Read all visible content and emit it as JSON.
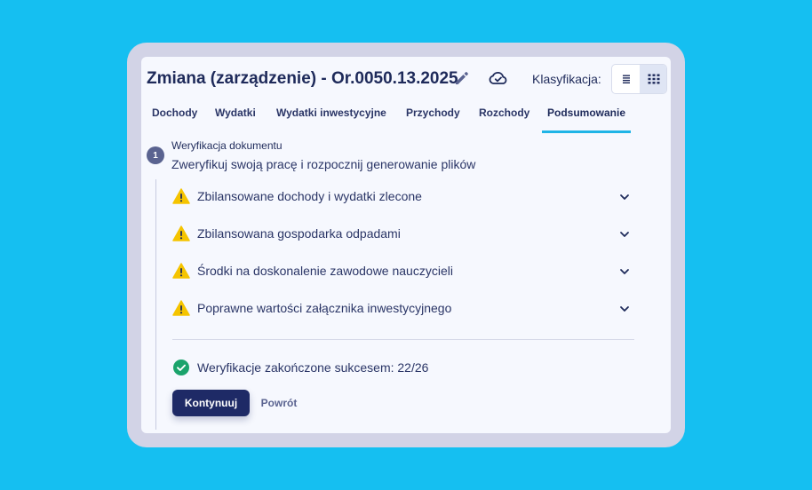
{
  "header": {
    "title": "Zmiana (zarządzenie) - Or.0050.13.2025",
    "classification_label": "Klasyfikacja:",
    "edit_icon": "pencil-icon",
    "cloud_icon": "cloud-check-icon",
    "view_modes": [
      "list-view-icon",
      "grid-view-icon"
    ],
    "active_view": "grid"
  },
  "tabs": [
    {
      "label": "Dochody",
      "active": false
    },
    {
      "label": "Wydatki",
      "active": false
    },
    {
      "label": "Wydatki inwestycyjne",
      "active": false
    },
    {
      "label": "Przychody",
      "active": false
    },
    {
      "label": "Rozchody",
      "active": false
    },
    {
      "label": "Podsumowanie",
      "active": true
    }
  ],
  "step": {
    "number": "1",
    "title": "Weryfikacja dokumentu",
    "description": "Zweryfikuj swoją pracę i rozpocznij generowanie plików"
  },
  "checks": [
    {
      "label": "Zbilansowane dochody i wydatki zlecone",
      "status": "warning"
    },
    {
      "label": "Zbilansowana gospodarka odpadami",
      "status": "warning"
    },
    {
      "label": "Środki na doskonalenie zawodowe nauczycieli",
      "status": "warning"
    },
    {
      "label": "Poprawne wartości załącznika inwestycyjnego",
      "status": "warning"
    }
  ],
  "summary": {
    "text": "Weryfikacje zakończone sukcesem: 22/26"
  },
  "actions": {
    "continue_label": "Kontynuuj",
    "back_label": "Powrót"
  },
  "colors": {
    "background": "#15bff1",
    "primary": "#1e2a66",
    "accent_tab": "#1fb4e6",
    "warning": "#f5c400",
    "success": "#1aa36b"
  }
}
